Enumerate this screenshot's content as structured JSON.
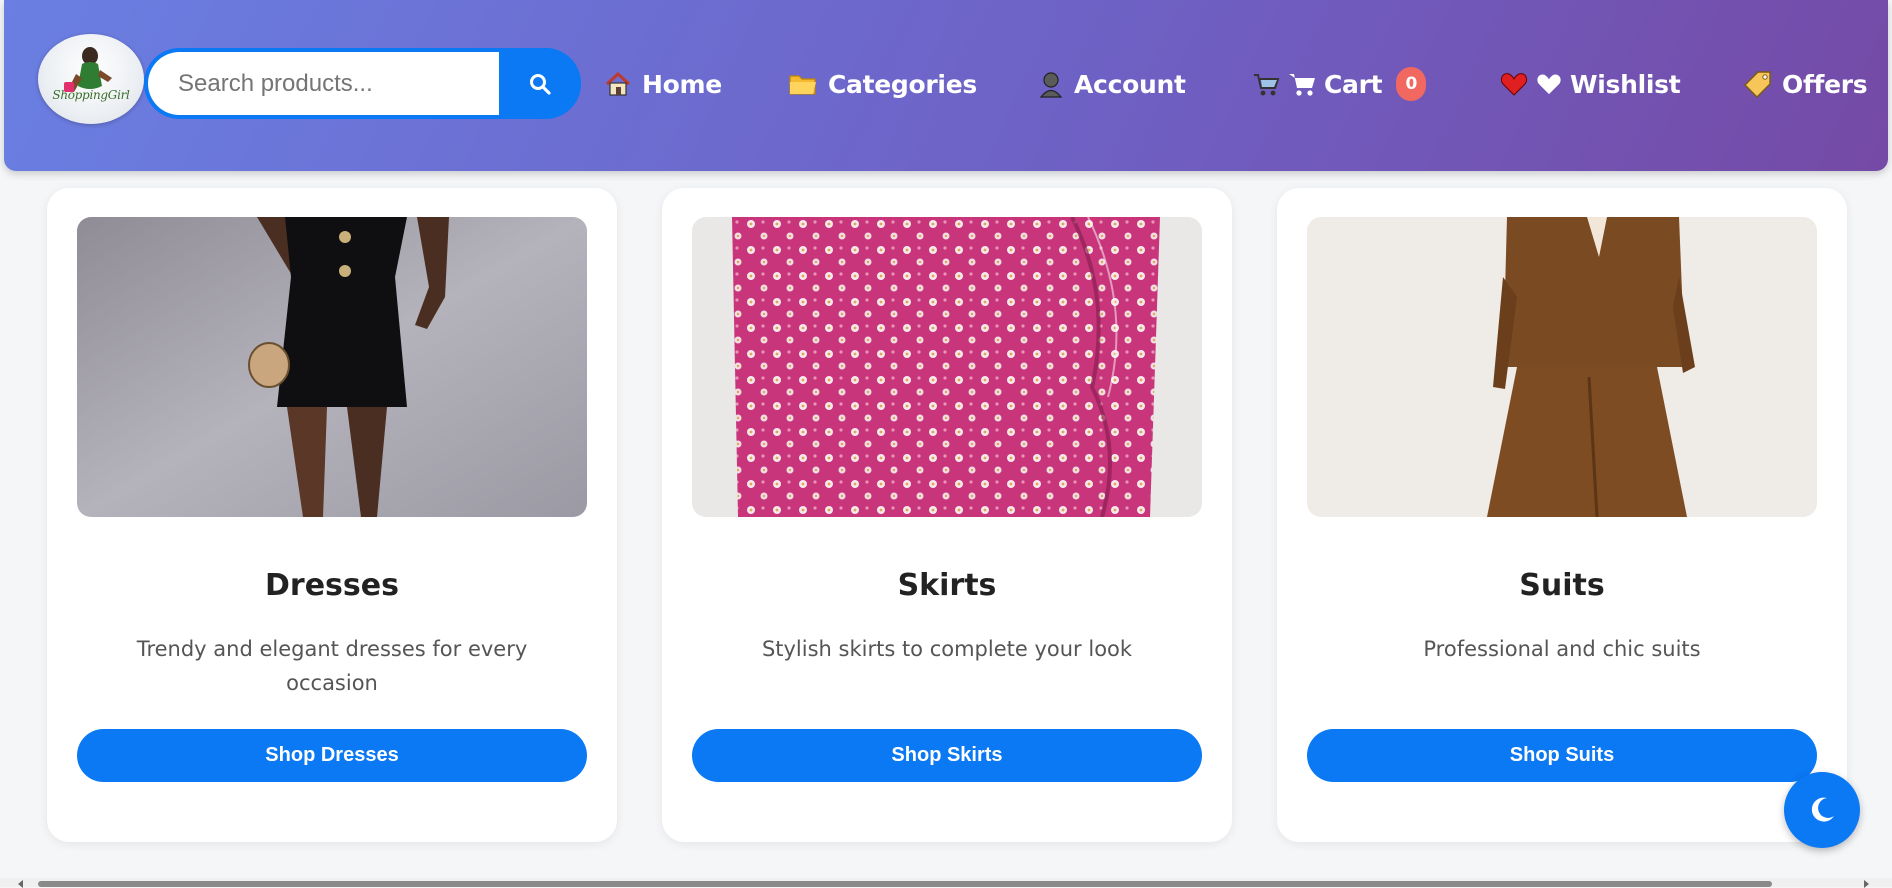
{
  "header": {
    "logo_text": "ShoppingGirl",
    "search": {
      "placeholder": "Search products...",
      "value": ""
    },
    "nav": [
      {
        "label": "Home",
        "icon": "house-icon"
      },
      {
        "label": "Categories",
        "icon": "folder-icon"
      },
      {
        "label": "Account",
        "icon": "user-icon"
      },
      {
        "label": "Cart",
        "icon": "cart-icon",
        "badge": "0"
      },
      {
        "label": "Wishlist",
        "icon": "heart-icon"
      },
      {
        "label": "Offers",
        "icon": "tag-icon"
      }
    ]
  },
  "categories": [
    {
      "title": "Dresses",
      "description": "Trendy and elegant dresses for every occasion",
      "button": "Shop Dresses",
      "image": "black-dress-photo"
    },
    {
      "title": "Skirts",
      "description": "Stylish skirts to complete your look",
      "button": "Shop Skirts",
      "image": "pink-floral-skirt-photo"
    },
    {
      "title": "Suits",
      "description": "Professional and chic suits",
      "button": "Shop Suits",
      "image": "brown-suit-photo"
    }
  ],
  "theme_toggle": {
    "icon": "moon-icon"
  },
  "colors": {
    "primary": "#0b78f4",
    "header_gradient_start": "#6a7fe2",
    "header_gradient_end": "#754aa6",
    "badge": "#f0685f"
  }
}
